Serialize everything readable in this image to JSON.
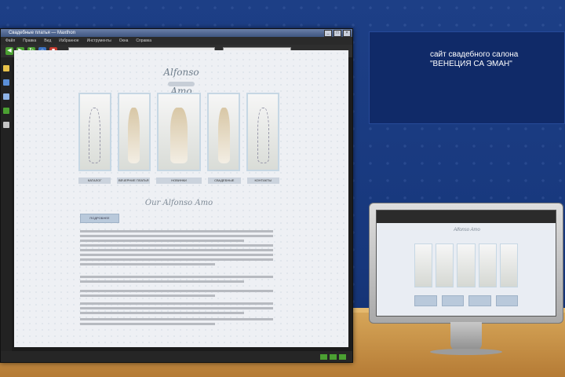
{
  "browser": {
    "title": "Свадебные платья — Maxthon",
    "menu": [
      "Файл",
      "Правка",
      "Вид",
      "Избранное",
      "Инструменты",
      "Окна",
      "Справка"
    ],
    "window_buttons": [
      "_",
      "□",
      "×"
    ]
  },
  "page": {
    "logo_text": "Alfonso Amo",
    "dress_labels": [
      "КАТАЛОГ",
      "ВЕЧЕРНИЕ ПЛАТЬЯ",
      "НОВИНКИ",
      "СВАДЕБНЫЕ",
      "КОНТАКТЫ"
    ],
    "subtitle": "Our Alfonso Amo",
    "button_label": "ПОДРОБНЕЕ"
  },
  "banner": {
    "line1": "сайт свадебного салона",
    "line2": "\"ВЕНЕЦИЯ СА ЭМАН\""
  },
  "colors": {
    "wall": "#1d3f86",
    "desk": "#d9a95b",
    "banner": "#102a68",
    "accent": "#4ba032"
  }
}
